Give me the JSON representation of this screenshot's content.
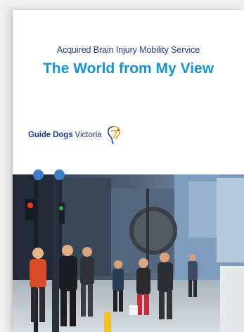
{
  "cover": {
    "subtitle": "Acquired Brain Injury Mobility Service",
    "title": "The World from My View",
    "brand": {
      "name_bold": "Guide Dogs",
      "name_regular": "Victoria",
      "logo_icon": "guide-dogs-dog-logo"
    },
    "photo": {
      "icon": "street-crossing-photo"
    },
    "colors": {
      "subtitle": "#243a82",
      "title": "#1a92d4",
      "brand": "#1f3b8c",
      "dots": "#3f7fc7"
    }
  }
}
